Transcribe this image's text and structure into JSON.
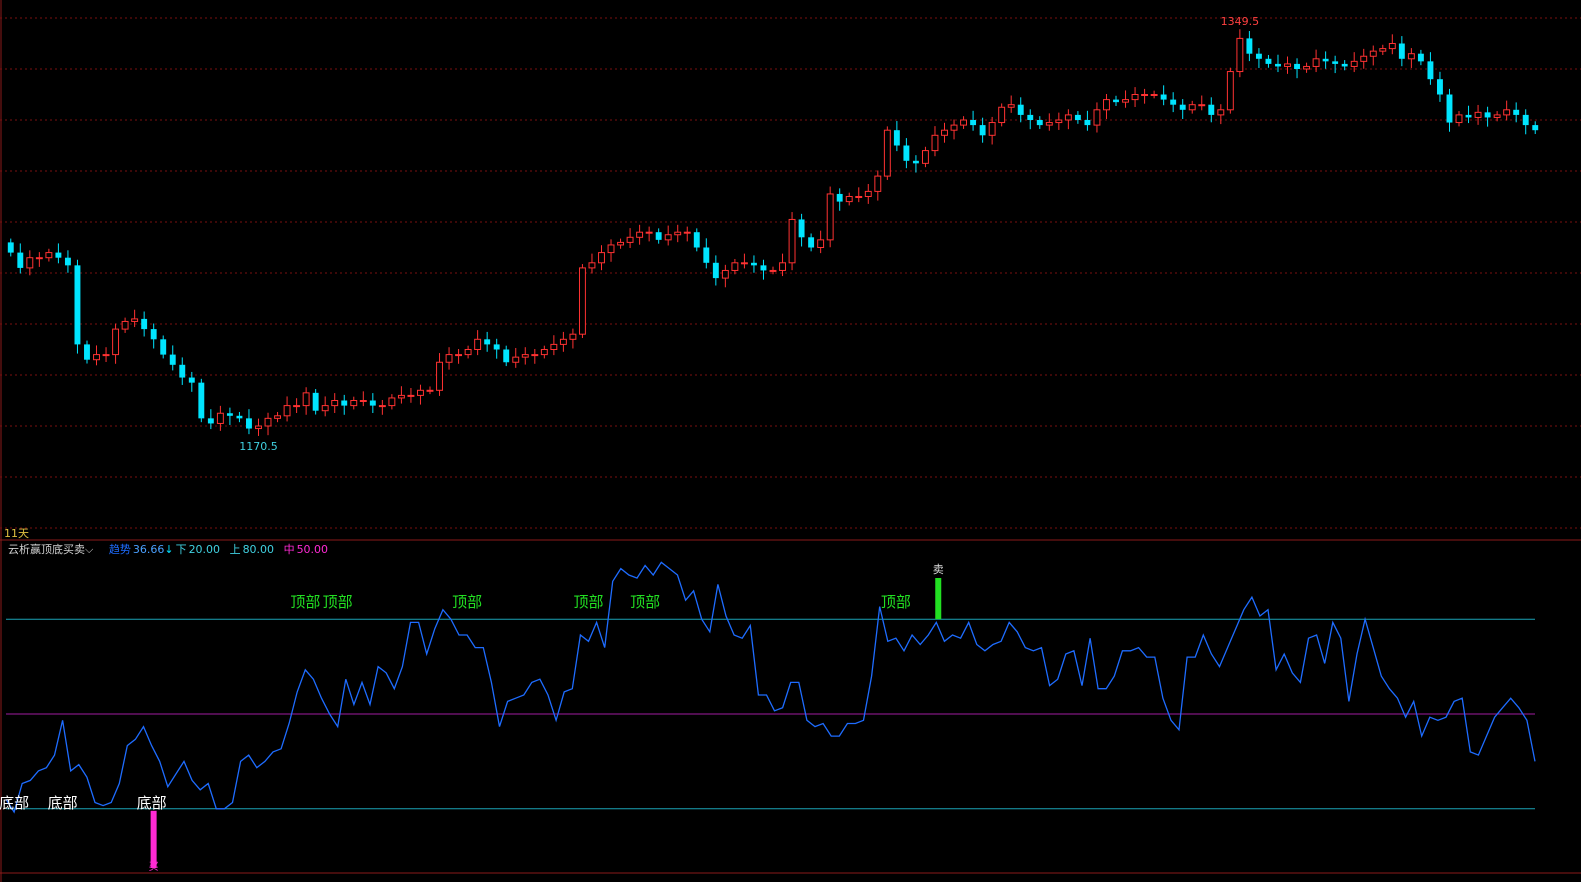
{
  "window": {
    "period_label": "11天"
  },
  "indicator_header": {
    "name": "云析赢顶底买卖",
    "dropdown_icon": "chevron-down-icon",
    "trend_label": "趋势",
    "trend_value": "36.66",
    "trend_arrow": "↓",
    "low_label": "下",
    "low_value": "20.00",
    "up_label": "上",
    "up_value": "80.00",
    "mid_label": "中",
    "mid_value": "50.00"
  },
  "colors": {
    "background": "#000000",
    "up_candle": "#ff3232",
    "down_candle": "#00e5ff",
    "grid": "#7a1010",
    "trend_line": "#1e6cff",
    "level_line": "#1aa3b5",
    "mid_line": "#a01ca0",
    "top_text": "#22e022",
    "bottom_text": "#ffffff",
    "buy_bar": "#ff2ad4",
    "sell_bar": "#22e022",
    "high_label": "#ff4040",
    "low_label_color": "#40d0e0"
  },
  "chart_data": [
    {
      "type": "candlestick",
      "price_range": [
        1160,
        1360
      ],
      "high_annotation": "1349.5",
      "low_annotation": "1170.5",
      "close": [
        1268,
        1262,
        1266,
        1266,
        1268,
        1266,
        1263,
        1232,
        1226,
        1228,
        1228,
        1238,
        1241,
        1242,
        1238,
        1234,
        1228,
        1224,
        1219,
        1217,
        1203,
        1201,
        1205,
        1204,
        1203,
        1199,
        1200,
        1203,
        1204,
        1208,
        1208,
        1213,
        1206,
        1208,
        1210,
        1208,
        1210,
        1210,
        1208,
        1208,
        1211,
        1212,
        1212,
        1214,
        1214,
        1225,
        1228,
        1228,
        1230,
        1234,
        1232,
        1230,
        1225,
        1227,
        1228,
        1228,
        1230,
        1232,
        1234,
        1236,
        1262,
        1264,
        1268,
        1271,
        1272,
        1274,
        1276,
        1276,
        1273,
        1275,
        1276,
        1276,
        1270,
        1264,
        1258,
        1261,
        1264,
        1264,
        1263,
        1261,
        1261,
        1264,
        1281,
        1274,
        1270,
        1273,
        1291,
        1288,
        1290,
        1290,
        1292,
        1298,
        1316,
        1310,
        1304,
        1303,
        1308,
        1314,
        1316,
        1318,
        1320,
        1318,
        1314,
        1319,
        1325,
        1326,
        1322,
        1320,
        1318,
        1319,
        1320,
        1322,
        1320,
        1318,
        1324,
        1328,
        1327,
        1328,
        1330,
        1330,
        1330,
        1328,
        1326,
        1324,
        1326,
        1326,
        1322,
        1324,
        1339,
        1352,
        1346,
        1344,
        1342,
        1341,
        1342,
        1340,
        1341,
        1344,
        1343,
        1342,
        1341,
        1343,
        1345,
        1347,
        1348,
        1350,
        1344,
        1346,
        1343,
        1336,
        1330,
        1319,
        1322,
        1321,
        1323,
        1321,
        1322,
        1324,
        1322,
        1318,
        1316
      ],
      "x_start_date": null
    },
    {
      "type": "line",
      "name": "趋势",
      "y_range": [
        0,
        100
      ],
      "levels": {
        "low": 20,
        "mid": 50,
        "up": 80
      },
      "values": [
        23,
        19,
        28,
        29,
        32,
        33,
        37,
        48,
        32,
        34,
        30,
        22,
        21,
        22,
        28,
        40,
        42,
        46,
        40,
        35,
        27,
        31,
        35,
        29,
        26,
        28,
        20,
        20,
        22,
        35,
        37,
        33,
        35,
        38,
        39,
        47,
        57,
        64,
        61,
        55,
        50,
        46,
        61,
        53,
        60,
        53,
        65,
        63,
        58,
        65,
        79,
        79,
        69,
        77,
        83,
        80,
        75,
        75,
        71,
        71,
        60,
        46,
        54,
        55,
        56,
        60,
        61,
        56,
        48,
        57,
        58,
        75,
        73,
        79,
        71,
        92,
        96,
        94,
        93,
        97,
        94,
        98,
        96,
        94,
        86,
        89,
        80,
        76,
        91,
        81,
        75,
        74,
        78,
        56,
        56,
        51,
        52,
        60,
        60,
        48,
        46,
        47,
        43,
        43,
        47,
        47,
        48,
        62,
        84,
        73,
        74,
        70,
        75,
        72,
        75,
        79,
        73,
        75,
        74,
        79,
        72,
        70,
        72,
        73,
        79,
        76,
        71,
        70,
        71,
        59,
        61,
        69,
        70,
        59,
        74,
        58,
        58,
        62,
        70,
        70,
        71,
        68,
        68,
        55,
        48,
        45,
        68,
        68,
        75,
        69,
        65,
        71,
        77,
        83,
        87,
        81,
        83,
        64,
        69,
        63,
        60,
        74,
        75,
        66,
        79,
        74,
        54,
        69,
        80,
        71,
        62,
        58,
        55,
        49,
        54,
        43,
        49,
        48,
        49,
        54,
        55,
        38,
        37,
        43,
        49,
        52,
        55,
        52,
        48,
        35
      ],
      "top_markers": [
        {
          "index": 37,
          "text": "顶部"
        },
        {
          "index": 41,
          "text": "顶部"
        },
        {
          "index": 57,
          "text": "顶部"
        },
        {
          "index": 72,
          "text": "顶部"
        },
        {
          "index": 79,
          "text": "顶部"
        },
        {
          "index": 110,
          "text": "顶部"
        }
      ],
      "bottom_markers": [
        {
          "index": 1,
          "text": "底部"
        },
        {
          "index": 7,
          "text": "底部"
        },
        {
          "index": 18,
          "text": "底部"
        }
      ],
      "buy_signal": {
        "index": 18,
        "text": "买"
      },
      "sell_signal": {
        "index": 114,
        "text": "卖"
      }
    }
  ]
}
